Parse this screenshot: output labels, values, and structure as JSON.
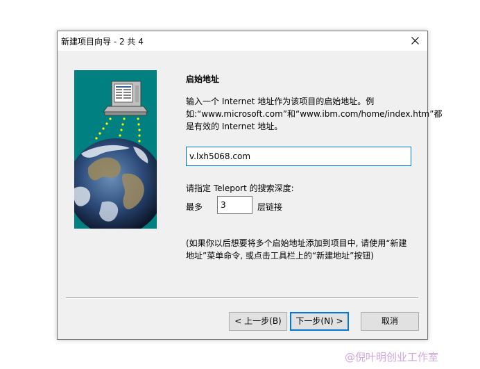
{
  "window": {
    "title": "新建项目向导 - 2 共 4"
  },
  "icons": {
    "close": "close-icon",
    "illustration": "computer-globe-illustration"
  },
  "page": {
    "heading": "启始地址",
    "description": "输入一个 Internet 地址作为该项目的启始地址。例如:“www.microsoft.com”和“www.ibm.com/home/index.htm”都是有效的 Internet 地址。",
    "url_value": "v.lxh5068.com",
    "depth_label": "请指定 Teleport 的搜索深度:",
    "max_label": "最多",
    "depth_value": "3",
    "levels_label": "层链接",
    "hint": "(如果你以后想要将多个启始地址添加到项目中, 请使用“新建地址”菜单命令, 或点击工具栏上的“新建地址”按钮)"
  },
  "buttons": {
    "back": "< 上一步(B)",
    "next": "下一步(N) >",
    "cancel": "取消"
  },
  "watermark": "@倪叶明创业工作室",
  "colors": {
    "illustration_bg": "#008080",
    "focus_border": "#0078d7",
    "dialog_bg": "#f0f0f0",
    "watermark": "#cfa6e2"
  }
}
